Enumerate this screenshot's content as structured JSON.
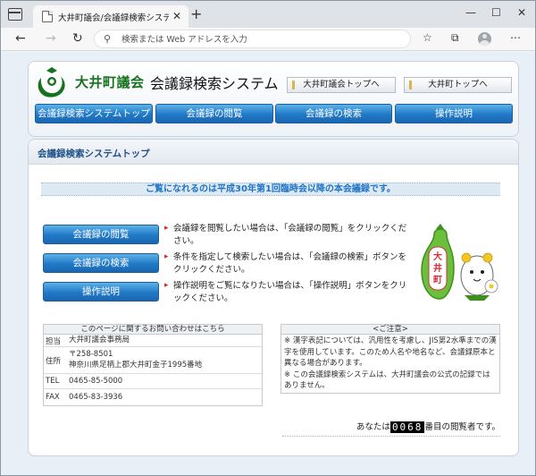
{
  "browser": {
    "tab_title": "大井町議会/会議録検索システム",
    "tab_close": "✕",
    "new_tab": "+",
    "address_placeholder": "検索または Web アドレスを入力",
    "win_minimize": "—",
    "win_maximize": "☐",
    "win_close": "✕"
  },
  "header": {
    "title_a": "大井町議会",
    "title_b": "会議録検索システム",
    "link_assembly_top": "大井町議会トップへ",
    "link_town_top": "大井町トップへ"
  },
  "nav": [
    {
      "label": "会議録検索システムトップ"
    },
    {
      "label": "会議録の閲覧"
    },
    {
      "label": "会議録の検索"
    },
    {
      "label": "操作説明"
    }
  ],
  "main": {
    "heading": "会議録検索システムトップ",
    "notice": "ご覧になれるのは平成30年第1回臨時会以降の本会議録です。",
    "actions": [
      {
        "label": "会議録の閲覧",
        "desc": "会議録を閲覧したい場合は、「会議録の閲覧」をクリックください。"
      },
      {
        "label": "会議録の検索",
        "desc": "条件を指定して検索したい場合は、「会議録の検索」ボタンをクリックください。"
      },
      {
        "label": "操作説明",
        "desc": "操作説明をご覧になりたい場合は、「操作説明」ボタンをクリックください。"
      }
    ],
    "mascot_text": "大井町"
  },
  "contact": {
    "title": "このページに関するお問い合わせはこちら",
    "rows": [
      {
        "label": "担当",
        "value": "大井町議会事務局"
      },
      {
        "label": "住所",
        "value": "〒258-8501",
        "value2": "神奈川県足柄上郡大井町金子1995番地"
      },
      {
        "label": "TEL",
        "value": "0465-85-5000"
      },
      {
        "label": "FAX",
        "value": "0465-83-3936"
      }
    ]
  },
  "caution": {
    "title": "<ご注意>",
    "p1": "※ 漢字表記については、汎用性を考慮し、JIS第2水準までの漢字を使用しています。このため人名や地名など、会議録原本と異なる場合があります。",
    "p2": "※ この会議録検索システムは、大井町議会の公式の記録ではありません。"
  },
  "counter": {
    "prefix": "あなたは",
    "digits": "0068",
    "suffix": "番目の閲覧者です。"
  },
  "colors": {
    "accent_blue": "#2179c6",
    "title_green": "#17711f",
    "notice_blue": "#1f74c8"
  }
}
